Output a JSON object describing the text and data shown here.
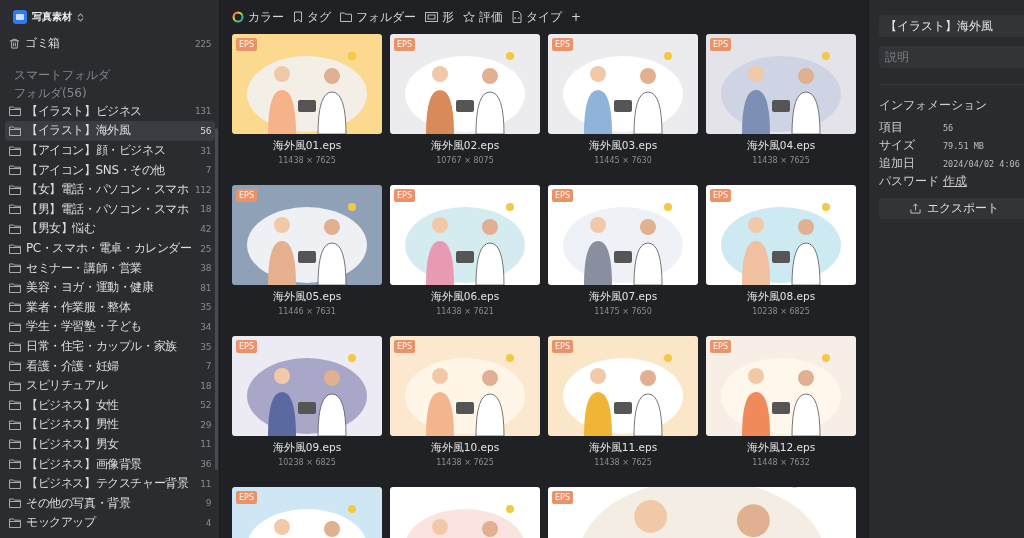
{
  "library": {
    "title": "写真素材"
  },
  "trash": {
    "label": "ゴミ箱",
    "count": "225"
  },
  "sections": [
    "スマートフォルダ",
    "フォルダ(56)"
  ],
  "folders": [
    {
      "label": "【イラスト】ビジネス",
      "count": "131",
      "selected": false
    },
    {
      "label": "【イラスト】海外風",
      "count": "56",
      "selected": true
    },
    {
      "label": "【アイコン】顔・ビジネス",
      "count": "31",
      "selected": false
    },
    {
      "label": "【アイコン】SNS・その他",
      "count": "7",
      "selected": false
    },
    {
      "label": "【女】電話・パソコン・スマホ",
      "count": "112",
      "selected": false
    },
    {
      "label": "【男】電話・パソコン・スマホ",
      "count": "18",
      "selected": false
    },
    {
      "label": "【男女】悩む",
      "count": "42",
      "selected": false
    },
    {
      "label": "PC・スマホ・電卓・カレンダー",
      "count": "25",
      "selected": false
    },
    {
      "label": "セミナー・講師・営業",
      "count": "38",
      "selected": false
    },
    {
      "label": "美容・ヨガ・運動・健康",
      "count": "81",
      "selected": false
    },
    {
      "label": "業者・作業服・整体",
      "count": "35",
      "selected": false
    },
    {
      "label": "学生・学習塾・子ども",
      "count": "34",
      "selected": false
    },
    {
      "label": "日常・住宅・カップル・家族",
      "count": "35",
      "selected": false
    },
    {
      "label": "看護・介護・妊婦",
      "count": "7",
      "selected": false
    },
    {
      "label": "スピリチュアル",
      "count": "18",
      "selected": false
    },
    {
      "label": "【ビジネス】女性",
      "count": "52",
      "selected": false
    },
    {
      "label": "【ビジネス】男性",
      "count": "29",
      "selected": false
    },
    {
      "label": "【ビジネス】男女",
      "count": "11",
      "selected": false
    },
    {
      "label": "【ビジネス】画像背景",
      "count": "36",
      "selected": false
    },
    {
      "label": "【ビジネス】テクスチャー背景",
      "count": "11",
      "selected": false
    },
    {
      "label": "その他の写真・背景",
      "count": "9",
      "selected": false
    },
    {
      "label": "モックアップ",
      "count": "4",
      "selected": false
    }
  ],
  "filters": [
    {
      "kind": "color",
      "label": "カラー"
    },
    {
      "kind": "tag",
      "label": "タグ"
    },
    {
      "kind": "folder",
      "label": "フォルダー"
    },
    {
      "kind": "shape",
      "label": "形"
    },
    {
      "kind": "rating",
      "label": "評価"
    },
    {
      "kind": "type",
      "label": "タイプ"
    },
    {
      "kind": "add",
      "label": "+"
    }
  ],
  "rows": [
    [
      {
        "kind": "picture",
        "badge": "EPS",
        "name": "海外風01.eps",
        "size": "11438 × 7625"
      },
      {
        "kind": "picture",
        "badge": "EPS",
        "name": "海外風02.eps",
        "size": "10767 × 8075"
      },
      {
        "kind": "picture",
        "badge": "EPS",
        "name": "海外風03.eps",
        "size": "11445 × 7630"
      },
      {
        "kind": "picture",
        "badge": "EPS",
        "name": "海外風04.eps",
        "size": "11438 × 7625"
      }
    ],
    [
      {
        "kind": "picture",
        "badge": "EPS",
        "name": "海外風05.eps",
        "size": "11446 × 7631"
      },
      {
        "kind": "picture",
        "badge": "EPS",
        "name": "海外風06.eps",
        "size": "11438 × 7621"
      },
      {
        "kind": "picture",
        "badge": "EPS",
        "name": "海外風07.eps",
        "size": "11475 × 7650"
      },
      {
        "kind": "picture",
        "badge": "EPS",
        "name": "海外風08.eps",
        "size": "10238 × 6825"
      }
    ],
    [
      {
        "kind": "picture",
        "badge": "EPS",
        "name": "海外風09.eps",
        "size": "10238 × 6825"
      },
      {
        "kind": "picture",
        "badge": "EPS",
        "name": "海外風10.eps",
        "size": "11438 × 7625"
      },
      {
        "kind": "picture",
        "badge": "EPS",
        "name": "海外風11.eps",
        "size": "11438 × 7625"
      },
      {
        "kind": "picture",
        "badge": "EPS",
        "name": "海外風12.eps",
        "size": "11448 × 7632"
      }
    ],
    [
      {
        "kind": "picture",
        "badge": "EPS"
      },
      {
        "kind": "picture"
      },
      {
        "kind": "picture",
        "badge": "EPS"
      }
    ]
  ],
  "inspector": {
    "title": "【イラスト】海外風",
    "description_placeholder": "説明",
    "section": "インフォメーション",
    "info": [
      {
        "key": "項目",
        "value": "56"
      },
      {
        "key": "サイズ",
        "value": "79.51 MB"
      },
      {
        "key": "追加日",
        "value": "2024/04/02 4:06"
      },
      {
        "key": "パスワード",
        "value": "作成",
        "kind": "link"
      }
    ],
    "export": "エクスポート"
  }
}
